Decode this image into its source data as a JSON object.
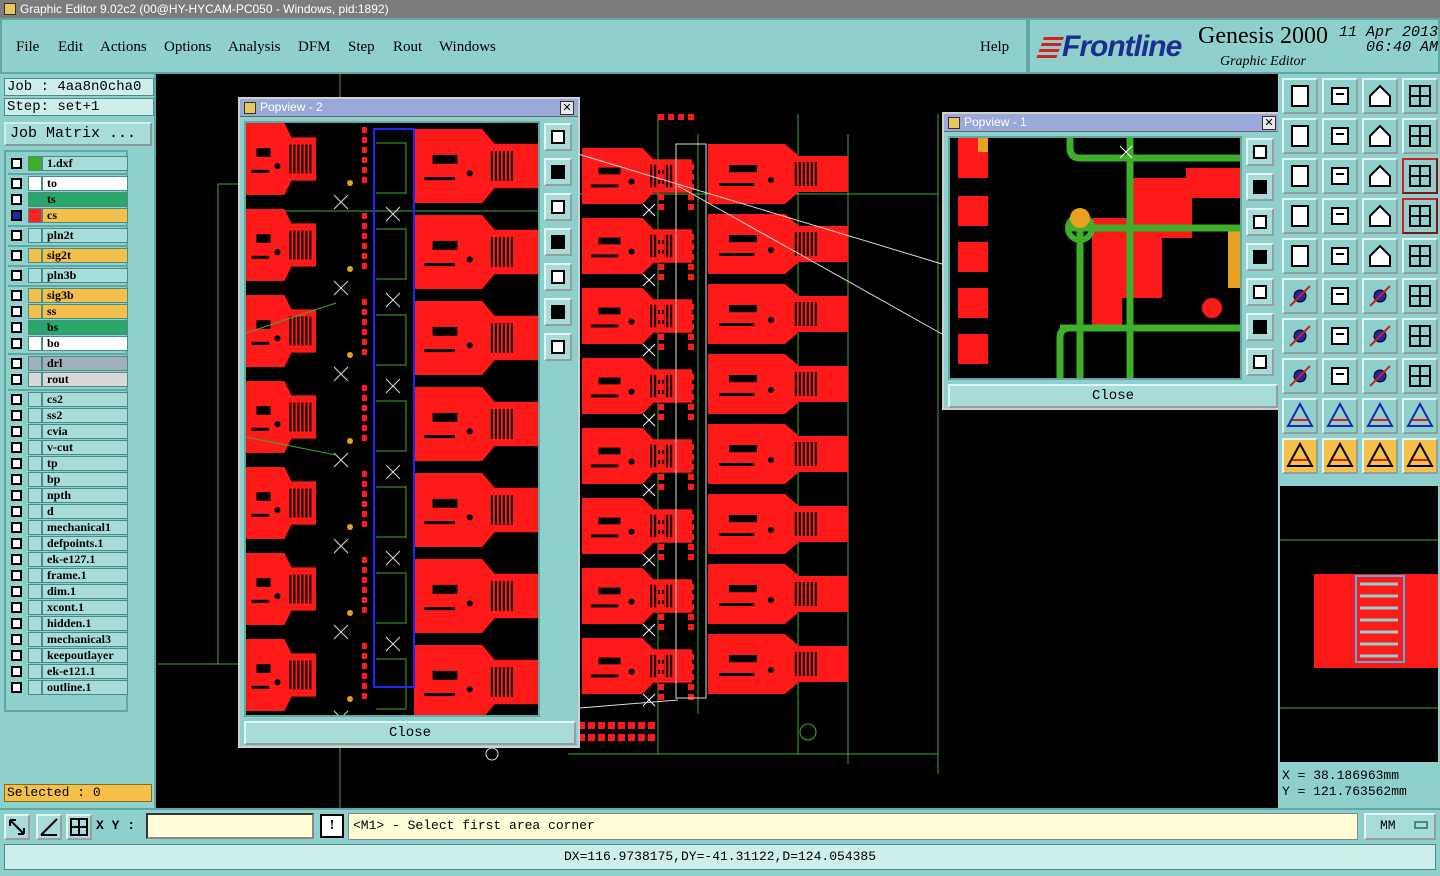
{
  "window": {
    "title": "Graphic Editor 9.02c2 (00@HY-HYCAM-PC050 - Windows, pid:1892)"
  },
  "menu": {
    "items": [
      "File",
      "Edit",
      "Actions",
      "Options",
      "Analysis",
      "DFM",
      "Step",
      "Rout",
      "Windows"
    ],
    "help": "Help"
  },
  "brand": {
    "logo": "Frontline",
    "product": "Genesis 2000",
    "subtitle": "Graphic Editor",
    "date": "11 Apr 2013",
    "time": "06:40 AM"
  },
  "job": {
    "job_line": "Job : 4aa8n0cha0",
    "step_line": "Step: set+1",
    "matrix_button": "Job Matrix ..."
  },
  "layers": [
    {
      "name": "1.dxf",
      "color": "#3fae2a",
      "bg": "#a8dcd8"
    },
    {
      "name": "to",
      "color": "#ffffff",
      "bg": "#ffffff"
    },
    {
      "name": "ts",
      "color": "#2aa86a",
      "bg": "#2aa86a"
    },
    {
      "name": "cs",
      "color": "#ff2020",
      "bg": "#f5c04a",
      "active": true
    },
    {
      "name": "pln2t",
      "color": "#a8dcd8",
      "bg": "#a8dcd8"
    },
    {
      "name": "sig2t",
      "color": "#f5c04a",
      "bg": "#f5c04a"
    },
    {
      "name": "pln3b",
      "color": "#a8dcd8",
      "bg": "#a8dcd8"
    },
    {
      "name": "sig3b",
      "color": "#f5c04a",
      "bg": "#f5c04a"
    },
    {
      "name": "ss",
      "color": "#f5c04a",
      "bg": "#f5c04a"
    },
    {
      "name": "bs",
      "color": "#2aa86a",
      "bg": "#2aa86a"
    },
    {
      "name": "bo",
      "color": "#ffffff",
      "bg": "#ffffff"
    },
    {
      "name": "drl",
      "color": "#a0b0b8",
      "bg": "#a0b0b8"
    },
    {
      "name": "rout",
      "color": "#d8d8d8",
      "bg": "#d8d8d8"
    },
    {
      "name": "cs2",
      "color": "#a8dcd8",
      "bg": "#a8dcd8"
    },
    {
      "name": "ss2",
      "color": "#a8dcd8",
      "bg": "#a8dcd8"
    },
    {
      "name": "cvia",
      "color": "#a8dcd8",
      "bg": "#a8dcd8"
    },
    {
      "name": "v-cut",
      "color": "#a8dcd8",
      "bg": "#a8dcd8"
    },
    {
      "name": "tp",
      "color": "#a8dcd8",
      "bg": "#a8dcd8"
    },
    {
      "name": "bp",
      "color": "#a8dcd8",
      "bg": "#a8dcd8"
    },
    {
      "name": "npth",
      "color": "#a8dcd8",
      "bg": "#a8dcd8"
    },
    {
      "name": "d",
      "color": "#a8dcd8",
      "bg": "#a8dcd8"
    },
    {
      "name": "mechanical1",
      "color": "#a8dcd8",
      "bg": "#a8dcd8"
    },
    {
      "name": "defpoints.1",
      "color": "#a8dcd8",
      "bg": "#a8dcd8"
    },
    {
      "name": "ek-e127.1",
      "color": "#a8dcd8",
      "bg": "#a8dcd8"
    },
    {
      "name": "frame.1",
      "color": "#a8dcd8",
      "bg": "#a8dcd8"
    },
    {
      "name": "dim.1",
      "color": "#a8dcd8",
      "bg": "#a8dcd8"
    },
    {
      "name": "xcont.1",
      "color": "#a8dcd8",
      "bg": "#a8dcd8"
    },
    {
      "name": "hidden.1",
      "color": "#a8dcd8",
      "bg": "#a8dcd8"
    },
    {
      "name": "mechanical3",
      "color": "#a8dcd8",
      "bg": "#a8dcd8"
    },
    {
      "name": "keepoutlayer",
      "color": "#a8dcd8",
      "bg": "#a8dcd8"
    },
    {
      "name": "ek-e121.1",
      "color": "#a8dcd8",
      "bg": "#a8dcd8"
    },
    {
      "name": "outline.1",
      "color": "#a8dcd8",
      "bg": "#a8dcd8"
    }
  ],
  "selected": "Selected : 0",
  "popview2": {
    "title": "Popview - 2",
    "close": "Close"
  },
  "popview1": {
    "title": "Popview - 1",
    "close": "Close"
  },
  "coords": {
    "x": "X = 38.186963mm",
    "y": "Y = 121.763562mm"
  },
  "bottom": {
    "xy_label": "X Y :",
    "xy_value": "",
    "prompt": "<M1> - Select first area corner",
    "units": "MM",
    "excl": "!"
  },
  "status": "DX=116.9738175,DY=-41.31122,D=124.054385",
  "colors": {
    "panel": "#8fd0cc",
    "copper": "#ff1a1a",
    "trace": "#3fae2a",
    "yellow": "#f5c04a"
  }
}
